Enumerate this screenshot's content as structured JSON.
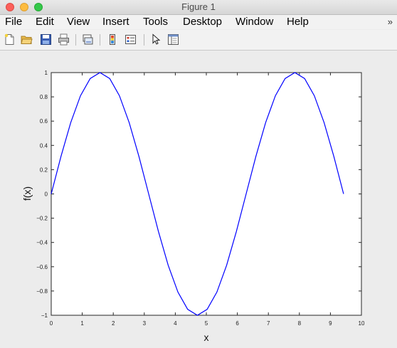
{
  "window": {
    "title": "Figure 1"
  },
  "menu": {
    "items": [
      "File",
      "Edit",
      "View",
      "Insert",
      "Tools",
      "Desktop",
      "Window",
      "Help"
    ],
    "overflow_icon": "double-chevron-right-icon"
  },
  "toolbar": {
    "icons": [
      "new-figure-icon",
      "open-file-icon",
      "save-icon",
      "print-icon",
      "link-icon",
      "colorbar-icon",
      "legend-icon",
      "pointer-icon",
      "property-editor-icon"
    ]
  },
  "chart_data": {
    "type": "line",
    "title": "",
    "xlabel": "x",
    "ylabel": "f(x)",
    "xlim": [
      0,
      10
    ],
    "ylim": [
      -1,
      1
    ],
    "xticks": [
      0,
      1,
      2,
      3,
      4,
      5,
      6,
      7,
      8,
      9,
      10
    ],
    "yticks": [
      -1,
      -0.8,
      -0.6,
      -0.4,
      -0.2,
      0,
      0.2,
      0.4,
      0.6,
      0.8,
      1
    ],
    "yticklabels": [
      "−1",
      "−0.8",
      "−0.6",
      "−0.4",
      "−0.2",
      "0",
      "0.2",
      "0.4",
      "0.6",
      "0.8",
      "1"
    ],
    "grid": false,
    "series": [
      {
        "color": "#0000ff",
        "x": [
          0,
          0.3142,
          0.6283,
          0.9425,
          1.2566,
          1.5708,
          1.885,
          2.1991,
          2.5133,
          2.8274,
          3.1416,
          3.4558,
          3.7699,
          4.0841,
          4.3982,
          4.7124,
          5.0265,
          5.3407,
          5.6549,
          5.969,
          6.2832,
          6.5973,
          6.9115,
          7.2257,
          7.5398,
          7.854,
          8.1681,
          8.4823,
          8.7965,
          9.1106,
          9.4248
        ],
        "y": [
          0,
          0.309,
          0.5878,
          0.809,
          0.9511,
          1,
          0.9511,
          0.809,
          0.5878,
          0.309,
          0,
          -0.309,
          -0.5878,
          -0.809,
          -0.9511,
          -1,
          -0.9511,
          -0.809,
          -0.5878,
          -0.309,
          0,
          0.309,
          0.5878,
          0.809,
          0.9511,
          1,
          0.9511,
          0.809,
          0.5878,
          0.309,
          0
        ]
      }
    ]
  }
}
